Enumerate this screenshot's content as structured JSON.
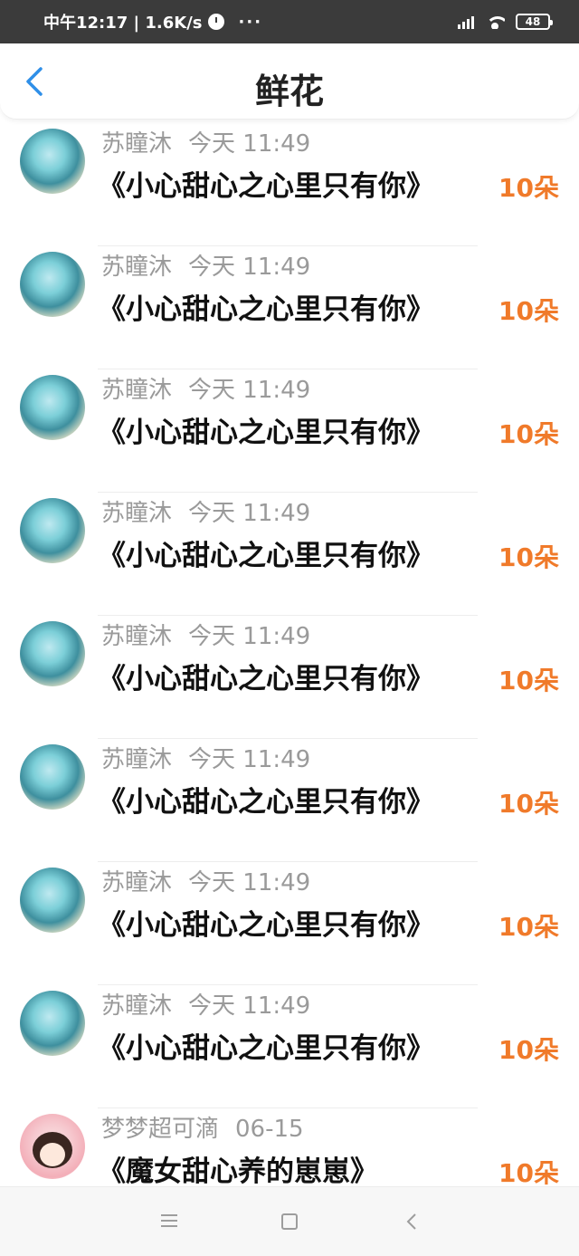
{
  "status_bar": {
    "time": "中午12:17 | 1.6K/s",
    "dots": "···",
    "battery": "48"
  },
  "header": {
    "title": "鲜花"
  },
  "items": [
    {
      "user": "苏瞳沐",
      "time": "今天 11:49",
      "title": "《小心甜心之心里只有你》",
      "count": "10朵"
    },
    {
      "user": "苏瞳沐",
      "time": "今天 11:49",
      "title": "《小心甜心之心里只有你》",
      "count": "10朵"
    },
    {
      "user": "苏瞳沐",
      "time": "今天 11:49",
      "title": "《小心甜心之心里只有你》",
      "count": "10朵"
    },
    {
      "user": "苏瞳沐",
      "time": "今天 11:49",
      "title": "《小心甜心之心里只有你》",
      "count": "10朵"
    },
    {
      "user": "苏瞳沐",
      "time": "今天 11:49",
      "title": "《小心甜心之心里只有你》",
      "count": "10朵"
    },
    {
      "user": "苏瞳沐",
      "time": "今天 11:49",
      "title": "《小心甜心之心里只有你》",
      "count": "10朵"
    },
    {
      "user": "苏瞳沐",
      "time": "今天 11:49",
      "title": "《小心甜心之心里只有你》",
      "count": "10朵"
    },
    {
      "user": "苏瞳沐",
      "time": "今天 11:49",
      "title": "《小心甜心之心里只有你》",
      "count": "10朵"
    },
    {
      "user": "梦梦超可滴",
      "time": "06-15",
      "title": "《魔女甜心养的崽崽》",
      "count": "10朵"
    }
  ],
  "colors": {
    "accent": "#2f8fe8",
    "count": "#f07a2a",
    "status_bar": "#3b3b3b"
  },
  "icons": {
    "back": "chevron-left-icon",
    "clock": "alarm-icon",
    "signal": "signal-icon",
    "wifi": "wifi-icon",
    "battery": "battery-icon"
  }
}
